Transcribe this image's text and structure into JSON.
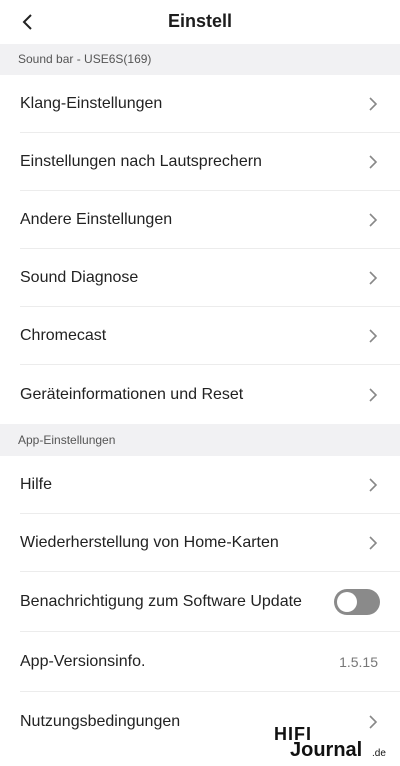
{
  "header": {
    "title": "Einstell"
  },
  "sections": [
    {
      "label": "Sound bar - USE6S(169)"
    },
    {
      "label": "App-Einstellungen"
    }
  ],
  "soundbar_items": [
    {
      "label": "Klang-Einstellungen"
    },
    {
      "label": "Einstellungen nach Lautsprechern"
    },
    {
      "label": "Andere Einstellungen"
    },
    {
      "label": "Sound Diagnose"
    },
    {
      "label": "Chromecast"
    },
    {
      "label": "Geräteinformationen und Reset"
    }
  ],
  "app_items": [
    {
      "label": "Hilfe"
    },
    {
      "label": "Wiederherstellung von Home-Karten"
    },
    {
      "label": "Benachrichtigung zum Software Update",
      "toggle": "off"
    },
    {
      "label": "App-Versionsinfo.",
      "value": "1.5.15"
    },
    {
      "label": "Nutzungsbedingungen"
    }
  ],
  "watermark": {
    "text_main": "HIFI",
    "text_sub": "Journal",
    "text_tld": ".de"
  },
  "colors": {
    "section_bg": "#f1f1f3",
    "toggle_off": "#8a8a8a",
    "divider": "#ececec"
  }
}
